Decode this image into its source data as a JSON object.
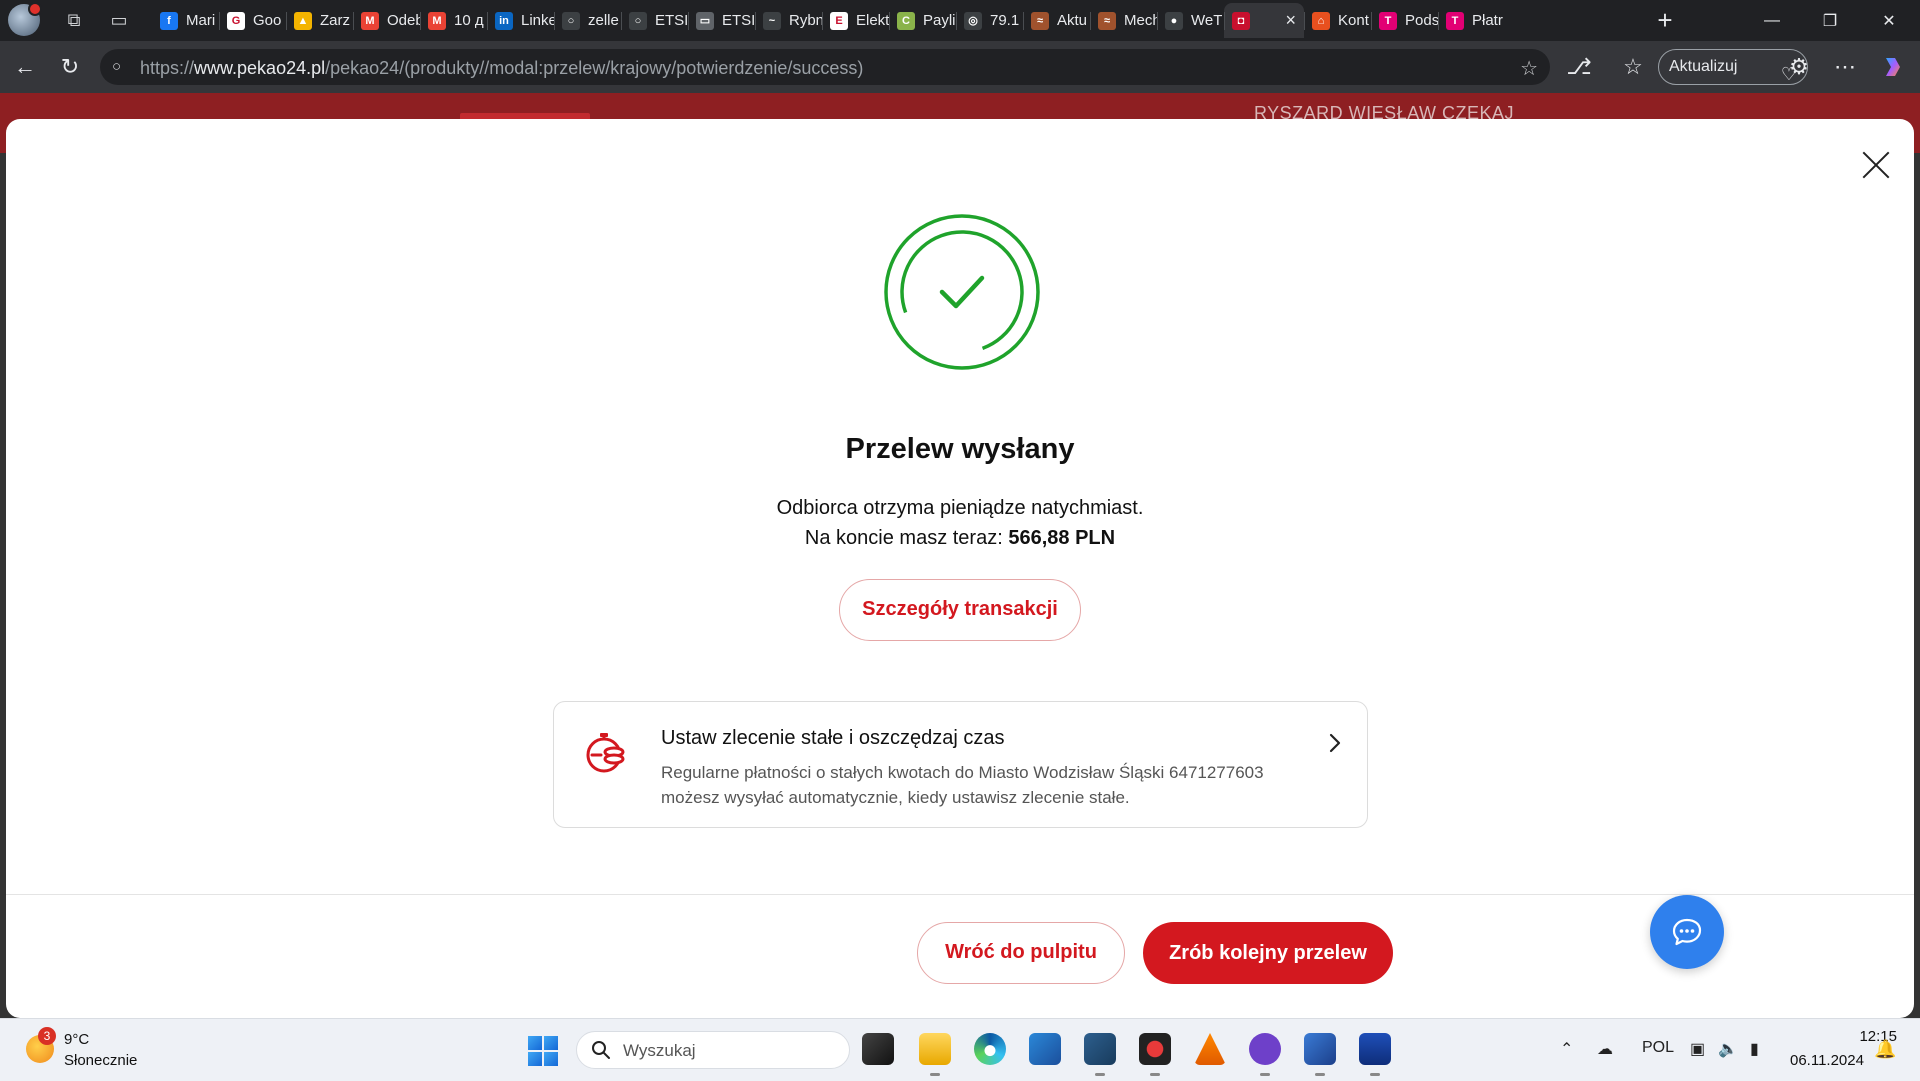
{
  "browser": {
    "tabs": [
      {
        "title": "Mari",
        "favicon_color": "#1877f2",
        "favicon_glyph": "f"
      },
      {
        "title": "Goo",
        "favicon_color": "#ffffff",
        "favicon_glyph": "G"
      },
      {
        "title": "Zarz",
        "favicon_color": "#f4b400",
        "favicon_glyph": "▲"
      },
      {
        "title": "Odeb",
        "favicon_color": "#ea4335",
        "favicon_glyph": "M"
      },
      {
        "title": "10 д",
        "favicon_color": "#ea4335",
        "favicon_glyph": "M"
      },
      {
        "title": "Linke",
        "favicon_color": "#0a66c2",
        "favicon_glyph": "in"
      },
      {
        "title": "zelle",
        "favicon_color": "#3c4043",
        "favicon_glyph": "○"
      },
      {
        "title": "ETSI",
        "favicon_color": "#3c4043",
        "favicon_glyph": "○"
      },
      {
        "title": "ETSI",
        "favicon_color": "#5f6368",
        "favicon_glyph": "▭"
      },
      {
        "title": "Rybn",
        "favicon_color": "#3c4043",
        "favicon_glyph": "~"
      },
      {
        "title": "Elekt",
        "favicon_color": "#ffffff",
        "favicon_glyph": "E"
      },
      {
        "title": "Payli",
        "favicon_color": "#8ab34a",
        "favicon_glyph": "C"
      },
      {
        "title": "79.1",
        "favicon_color": "#3c4043",
        "favicon_glyph": "◎"
      },
      {
        "title": "Aktu",
        "favicon_color": "#a0522d",
        "favicon_glyph": "≈"
      },
      {
        "title": "Mech",
        "favicon_color": "#a0522d",
        "favicon_glyph": "≈"
      },
      {
        "title": "WeT",
        "favicon_color": "#3c4043",
        "favicon_glyph": "●"
      },
      {
        "title": "",
        "favicon_color": "#c8102e",
        "favicon_glyph": "◘",
        "active": true
      },
      {
        "title": "Kont",
        "favicon_color": "#e8501f",
        "favicon_glyph": "⌂"
      },
      {
        "title": "Pods",
        "favicon_color": "#e20074",
        "favicon_glyph": "T"
      },
      {
        "title": "Płatr",
        "favicon_color": "#e20074",
        "favicon_glyph": "T"
      }
    ],
    "new_tab_label": "+",
    "url_prefix": "https://",
    "url_domain": "www.pekao24.pl",
    "url_path": "/pekao24/(produkty//modal:przelew/krajowy/potwierdzenie/success)",
    "update_button_label": "Aktualizuj",
    "icons": {
      "back": "back-arrow-icon",
      "reload": "reload-icon",
      "site_info": "site-info-icon",
      "favorite": "star-icon",
      "extensions": "puzzle-icon",
      "favorites": "favorites-icon",
      "more": "more-icon",
      "copilot": "copilot-icon"
    }
  },
  "bank_header": {
    "user_name": "RYSZARD WIESŁAW CZEKAJ",
    "brand_color": "#8e1f22"
  },
  "modal": {
    "title": "Przelew wysłany",
    "line1": "Odbiorca otrzyma pieniądze natychmiast.",
    "balance_prefix": "Na koncie masz teraz: ",
    "balance_amount": "566,88 PLN",
    "details_button": "Szczegóły transakcji",
    "promo": {
      "title": "Ustaw zlecenie stałe i oszczędzaj czas",
      "description": "Regularne płatności o stałych kwotach do Miasto Wodzisław Śląski 6471277603 możesz wysyłać automatycznie, kiedy ustawisz zlecenie stałe."
    },
    "back_button": "Wróć do pulpitu",
    "next_button": "Zrób kolejny przelew",
    "accent_color": "#d3181f",
    "success_color": "#1fa32b"
  },
  "taskbar": {
    "weather_temp": "9°C",
    "weather_desc": "Słonecznie",
    "weather_badge": "3",
    "search_placeholder": "Wyszukaj",
    "apps": [
      "task-view",
      "file-explorer",
      "edge",
      "microsoft-store",
      "virtualbox",
      "davinci",
      "vlc",
      "github-desktop",
      "network-tool",
      "save-tool"
    ],
    "language": "POL",
    "time": "12:15",
    "date": "06.11.2024"
  }
}
